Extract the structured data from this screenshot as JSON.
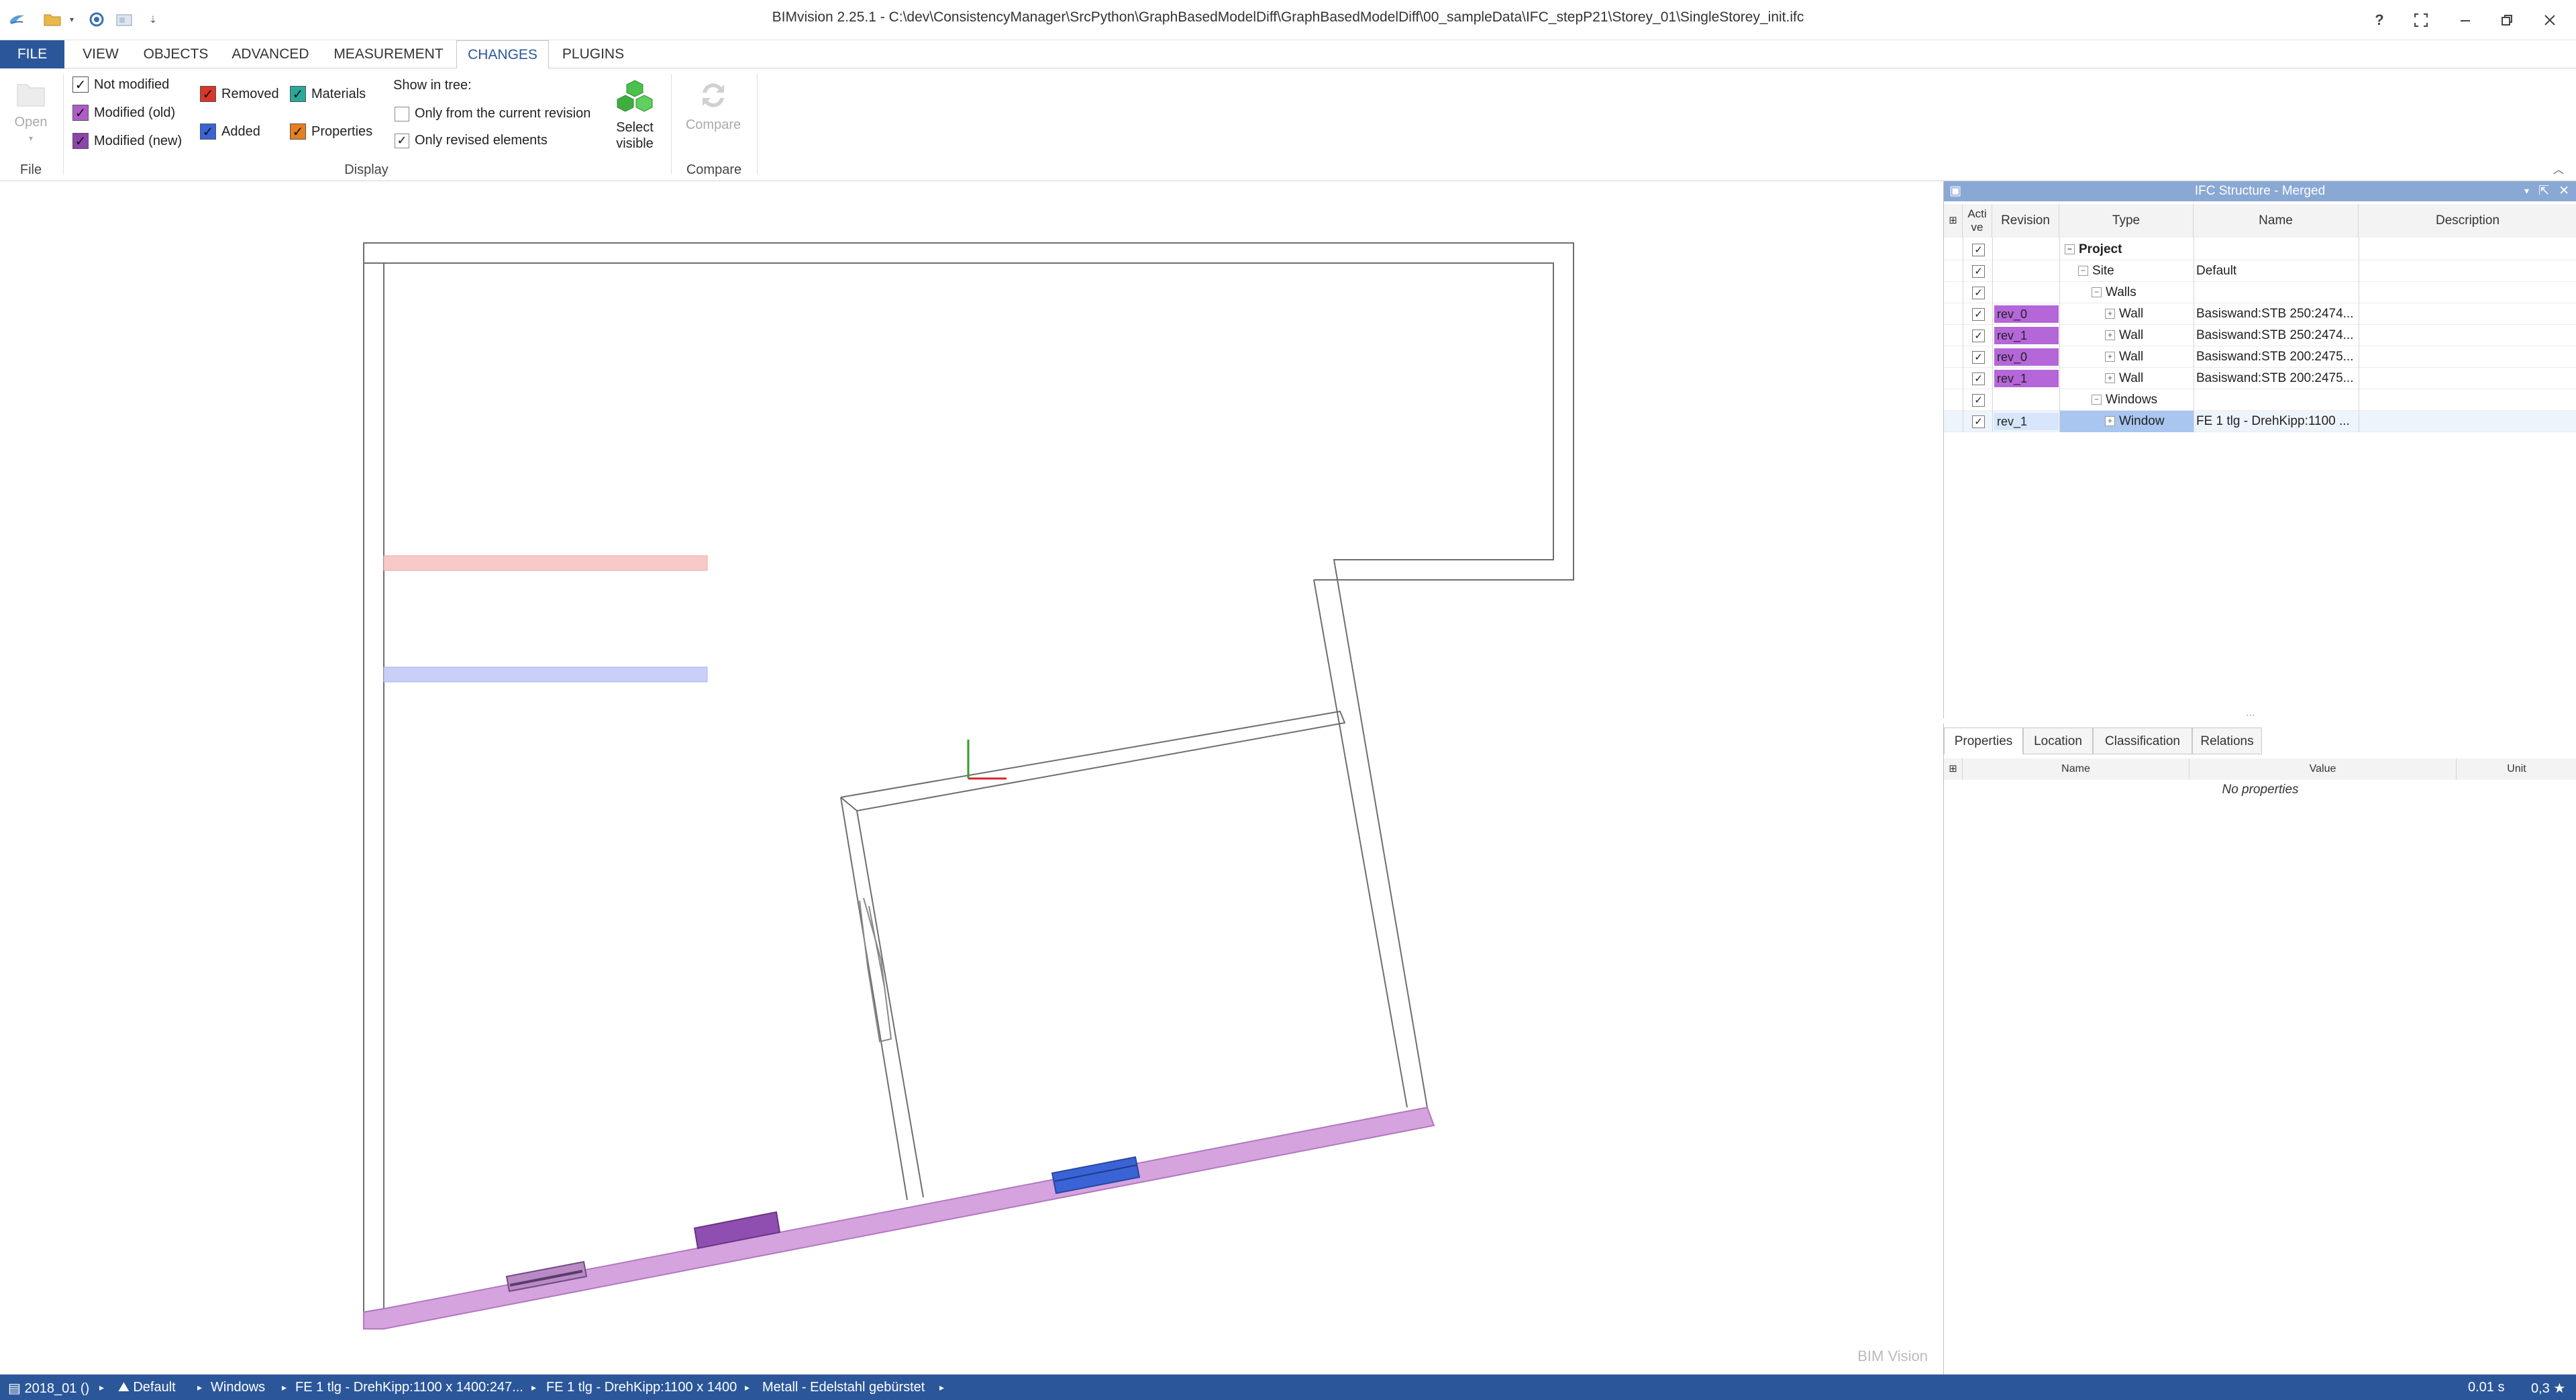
{
  "title_bar": {
    "title": "BIMvision 2.25.1 - C:\\dev\\ConsistencyManager\\SrcPython\\GraphBasedModelDiff\\GraphBasedModelDiff\\00_sampleData\\IFC_stepP21\\Storey_01\\SingleStorey_init.ifc",
    "help": "?"
  },
  "tabs": [
    {
      "label": "FILE"
    },
    {
      "label": "VIEW"
    },
    {
      "label": "OBJECTS"
    },
    {
      "label": "ADVANCED"
    },
    {
      "label": "MEASUREMENT"
    },
    {
      "label": "CHANGES"
    },
    {
      "label": "PLUGINS"
    }
  ],
  "ribbon": {
    "open_label": "Open",
    "file_group": "File",
    "display_group": "Display",
    "compare_group": "Compare",
    "checks": {
      "not_modified": "Not modified",
      "modified_old": "Modified (old)",
      "modified_new": "Modified (new)",
      "removed": "Removed",
      "added": "Added",
      "materials": "Materials",
      "properties": "Properties"
    },
    "show_in_tree_label": "Show in tree:",
    "only_current_revision": "Only from the current revision",
    "only_revised_elements": "Only revised elements",
    "select_visible_line1": "Select",
    "select_visible_line2": "visible",
    "compare_label": "Compare",
    "colors": {
      "not_modified": "#ffffff",
      "modified_old": "#b05cc7",
      "modified_new": "#8e44ad",
      "removed": "#d9352b",
      "added": "#3a63d6",
      "materials": "#2aa89a",
      "properties": "#e67e22"
    }
  },
  "tree_panel": {
    "title": "IFC Structure - Merged",
    "columns": {
      "active_line1": "Acti",
      "active_line2": "ve",
      "revision": "Revision",
      "type": "Type",
      "name": "Name",
      "description": "Description"
    },
    "rows": [
      {
        "revision": "",
        "type": "Project",
        "name": "",
        "level": 0,
        "expander": "−",
        "bold": true
      },
      {
        "revision": "",
        "type": "Site",
        "name": "Default",
        "level": 1,
        "expander": "−"
      },
      {
        "revision": "",
        "type": "Walls",
        "name": "",
        "level": 2,
        "expander": "−"
      },
      {
        "revision": "rev_0",
        "type": "Wall",
        "name": "Basiswand:STB 250:2474...",
        "level": 3,
        "expander": "+"
      },
      {
        "revision": "rev_1",
        "type": "Wall",
        "name": "Basiswand:STB 250:2474...",
        "level": 3,
        "expander": "+"
      },
      {
        "revision": "rev_0",
        "type": "Wall",
        "name": "Basiswand:STB 200:2475...",
        "level": 3,
        "expander": "+"
      },
      {
        "revision": "rev_1",
        "type": "Wall",
        "name": "Basiswand:STB 200:2475...",
        "level": 3,
        "expander": "+"
      },
      {
        "revision": "",
        "type": "Windows",
        "name": "",
        "level": 2,
        "expander": "−"
      },
      {
        "revision": "rev_1",
        "type": "Window",
        "name": "FE 1 tlg - DrehKipp:1100 ...",
        "level": 3,
        "expander": "+",
        "selected": true
      }
    ],
    "rev_color": "#b566d9",
    "selected_color": "#a8c6f0"
  },
  "props_panel": {
    "tabs": [
      "Properties",
      "Location",
      "Classification",
      "Relations"
    ],
    "columns": {
      "name": "Name",
      "value": "Value",
      "unit": "Unit"
    },
    "empty_text": "No properties"
  },
  "viewport": {
    "watermark": "BIM Vision",
    "wall_highlight_color": "#d5a3de",
    "removed_color": "#f7c9c9",
    "added_color": "#c9cff7",
    "window_new_color": "#3a63d6",
    "window_old_color": "#8e4fb0"
  },
  "status_bar": {
    "item1": "2018_01 ()",
    "item2": "Default",
    "item3": "Windows",
    "item4": "FE 1 tlg - DrehKipp:1100 x 1400:247...",
    "item5": "FE 1 tlg - DrehKipp:1100 x 1400",
    "item6": "Metall - Edelstahl gebürstet",
    "time": "0.01 s",
    "zoom": "0,3 ★"
  }
}
